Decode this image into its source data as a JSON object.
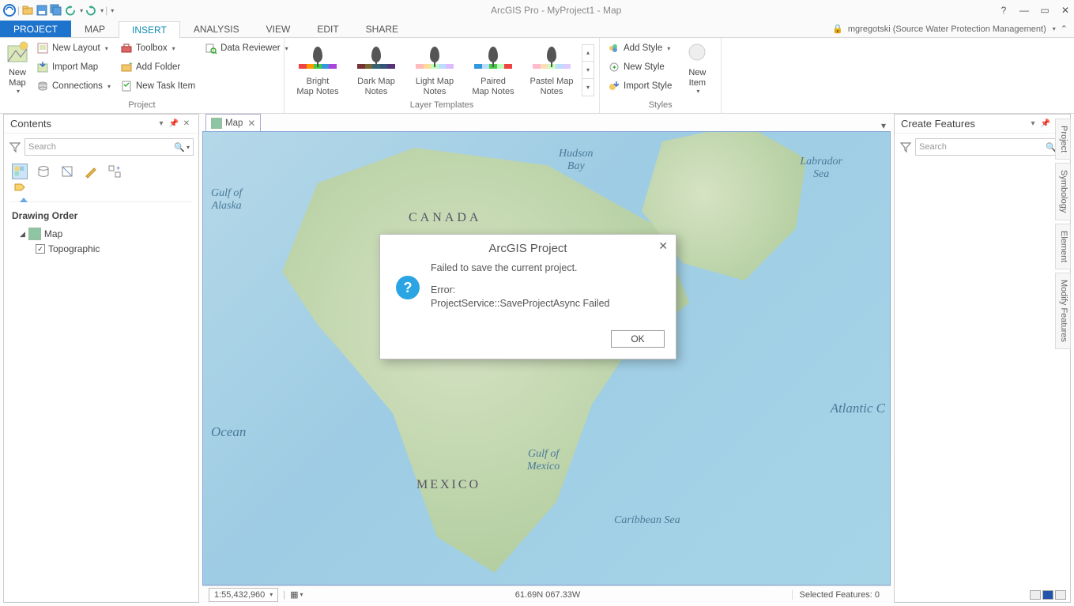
{
  "app": {
    "title": "ArcGIS Pro - MyProject1 - Map",
    "user": "mgregotski (Source Water Protection Management)"
  },
  "tabs": {
    "project": "PROJECT",
    "map": "MAP",
    "insert": "INSERT",
    "analysis": "ANALYSIS",
    "view": "VIEW",
    "edit": "EDIT",
    "share": "SHARE"
  },
  "ribbon": {
    "project": {
      "label": "Project",
      "new_map": "New\bMap",
      "new_layout": "New Layout",
      "import_map": "Import Map",
      "connections": "Connections",
      "toolbox": "Toolbox",
      "add_folder": "Add Folder",
      "new_task_item": "New Task Item",
      "data_reviewer": "Data Reviewer"
    },
    "layer_templates": {
      "label": "Layer Templates",
      "items": [
        {
          "line1": "Bright",
          "line2": "Map Notes"
        },
        {
          "line1": "Dark Map",
          "line2": "Notes"
        },
        {
          "line1": "Light Map",
          "line2": "Notes"
        },
        {
          "line1": "Paired",
          "line2": "Map Notes"
        },
        {
          "line1": "Pastel Map",
          "line2": "Notes"
        }
      ]
    },
    "styles": {
      "label": "Styles",
      "add_style": "Add Style",
      "new_style": "New Style",
      "import_style": "Import Style",
      "new_item": "New\bItem"
    }
  },
  "contents": {
    "title": "Contents",
    "search_placeholder": "Search",
    "drawing_order": "Drawing Order",
    "map_node": "Map",
    "layer": "Topographic"
  },
  "create": {
    "title": "Create Features",
    "search_placeholder": "Search"
  },
  "mapview": {
    "tab": "Map",
    "labels": {
      "hudson": "Hudson\bBay",
      "labrador": "Labrador\bSea",
      "gulf_alaska": "Gulf of\bAlaska",
      "canada": "CANADA",
      "atlantic": "Atlantic C",
      "ocean": "Ocean",
      "gulf_mexico": "Gulf of\bMexico",
      "mexico": "MEXICO",
      "caribbean": "Caribbean Sea"
    },
    "status": {
      "scale": "1:55,432,960",
      "coords": "61.69N 067.33W",
      "selected": "Selected Features: 0"
    }
  },
  "docked_tabs": [
    "Project",
    "Symbology",
    "Element",
    "Modify Features"
  ],
  "dialog": {
    "title": "ArcGIS Project",
    "line1": "Failed to save the current project.",
    "line2": "Error:",
    "line3": "ProjectService::SaveProjectAsync Failed",
    "ok": "OK"
  }
}
